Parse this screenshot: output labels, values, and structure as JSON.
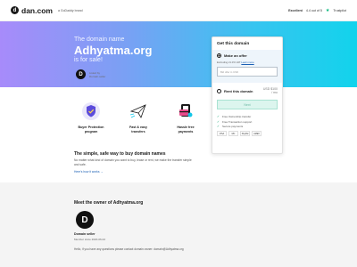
{
  "header": {
    "logo_letter": "d",
    "logo_text": "dan.com",
    "logo_sub": "a GoDaddy brand",
    "trust_label": "Excellent",
    "trust_rating": "4.4 out of 5",
    "trust_brand": "Trustpilot"
  },
  "hero": {
    "small": "The domain name",
    "domain": "Adhyatma.org",
    "sale": "is for sale!",
    "seller_letter": "D",
    "seller_line1": "Listed by",
    "seller_line2": "Domain seller"
  },
  "card": {
    "title": "Get this domain",
    "offer_label": "Make an offer",
    "offer_sub": "Excluding 21.0% VAT",
    "offer_link": "Learn more",
    "input_placeholder": "Bid offer in USD",
    "bin_label": "Rent this domain",
    "bin_price": "USD $100",
    "bin_price_sub": "/ mo",
    "next_label": "Next",
    "checks": [
      "Free Ownership transfer",
      "Free Transaction support",
      "Secure payments"
    ],
    "pay": [
      "VISA",
      "MC",
      "PayPal",
      "AMEX"
    ]
  },
  "features": [
    {
      "label_1": "Buyer Protection",
      "label_2": "program",
      "icon": "shield-icon"
    },
    {
      "label_1": "Fast & easy",
      "label_2": "transfers",
      "icon": "paper-plane-icon"
    },
    {
      "label_1": "Hassle free",
      "label_2": "payments",
      "icon": "credit-card-icon"
    }
  ],
  "safe": {
    "title": "The simple, safe way to buy domain names",
    "desc": "No matter what kind of domain you want to buy, lease or rent, we make the transfer simple and safe.",
    "link": "Here's how it works →"
  },
  "owner": {
    "title": "Meet the owner of Adhyatma.org",
    "letter": "D",
    "role": "Domain seller",
    "since": "Member since 2020-06-02",
    "message": "Hello, if you have any questions please contact domain owner: domain@Adhyatma.org"
  },
  "colors": {
    "gradient_start": "#a78bfa",
    "gradient_end": "#12d3ec",
    "accent_green": "#17a673",
    "link_blue": "#1a5fb4"
  }
}
